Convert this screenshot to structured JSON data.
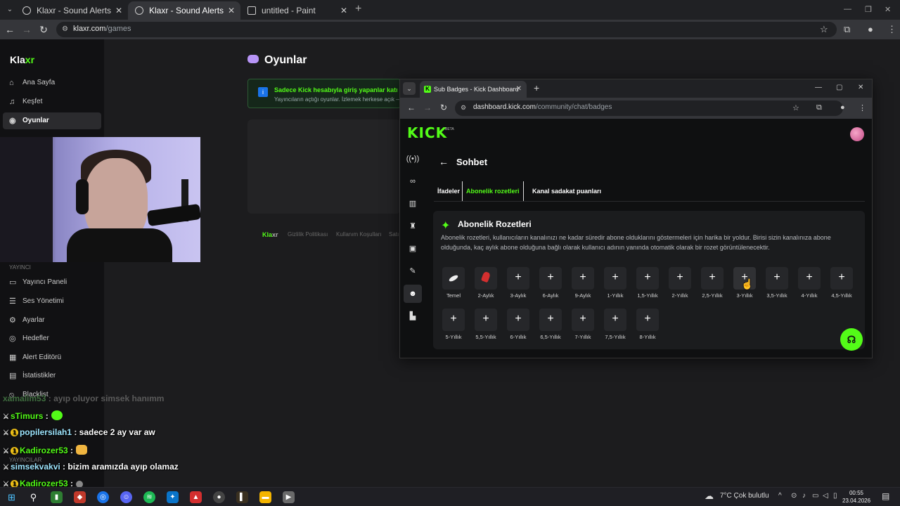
{
  "outer_browser": {
    "tabs": [
      {
        "label": "Klaxr - Sound Alerts",
        "active": false
      },
      {
        "label": "Klaxr - Sound Alerts",
        "active": true
      },
      {
        "label": "untitled - Paint",
        "active": false
      }
    ],
    "url_host": "klaxr.com",
    "url_path": "/games"
  },
  "klaxr": {
    "logo_a": "Kla",
    "logo_b": "xr",
    "nav": [
      {
        "label": "Ana Sayfa",
        "icon": "home-icon"
      },
      {
        "label": "Keşfet",
        "icon": "music-icon"
      },
      {
        "label": "Oyunlar",
        "icon": "gamepad-icon"
      }
    ],
    "section_streamer": "YAYINCI",
    "nav2": [
      {
        "label": "Yayıncı Paneli",
        "icon": "monitor-icon"
      },
      {
        "label": "Ses Yönetimi",
        "icon": "list-icon"
      },
      {
        "label": "Ayarlar",
        "icon": "gear-icon"
      },
      {
        "label": "Hedefler",
        "icon": "target-icon"
      },
      {
        "label": "Alert Editörü",
        "icon": "grid-icon"
      },
      {
        "label": "İstatistikler",
        "icon": "chart-icon"
      },
      {
        "label": "Blacklist",
        "icon": "block-icon"
      }
    ],
    "section_streamers": "YAYINCILAR",
    "page_title": "Oyunlar",
    "info_title": "Sadece Kick hesabıyla giriş yapanlar katı",
    "info_sub": "Yayıncıların açtığı oyunlar. İzlemek herkese açık —",
    "footer_logo_a": "Kla",
    "footer_logo_b": "xr",
    "footer_links": [
      "Gizlilik Politikası",
      "Kullanım Koşulları",
      "Satı"
    ]
  },
  "chat": [
    {
      "user": "xamalim53",
      "text": ": ayıp oluyor simsek hanımm",
      "faded": true
    },
    {
      "user": "sTimurs",
      "text": ":",
      "emote": true
    },
    {
      "user": "popilersilah1",
      "text": ": sadece 2 ay var aw",
      "badge": true,
      "cyan": true
    },
    {
      "user": "Kadirozer53",
      "text": ":",
      "badge": true,
      "emote_hand": true
    },
    {
      "user": "simsekvakvi",
      "text": ": bizim aramızda ayıp olamaz",
      "cyan": true
    },
    {
      "user": "Kadirozer53",
      "text": ":",
      "badge": true
    }
  ],
  "kick_window": {
    "tab_label": "Sub Badges - Kick Dashboard",
    "url_host": "dashboard.kick.com",
    "url_path": "/community/chat/badges",
    "logo": "KICK",
    "logo_beta": "BETA",
    "heading": "Sohbet",
    "tabs": [
      "İfadeler",
      "Abonelik rozetleri",
      "Kanal sadakat puanları"
    ],
    "card_title": "Abonelik Rozetleri",
    "card_desc": "Abonelik rozetleri, kullanıcıların kanalınızı ne kadar süredir abone olduklarını göstermeleri için harika bir yoldur. Birisi sizin kanalınıza abone olduğunda, kaç aylık abone olduğuna bağlı olarak kullanıcı adının yanında otomatik olarak bir rozet görüntülenecektir.",
    "badges_row1": [
      "Temel",
      "2-Aylık",
      "3-Aylık",
      "6-Aylık",
      "9-Aylık",
      "1-Yıllık",
      "1,5-Yıllık",
      "2-Yıllık",
      "2,5-Yıllık",
      "3-Yıllık",
      "3,5-Yıllık",
      "4-Yıllık",
      "4,5-Yıllık"
    ],
    "badges_row2": [
      "5-Yıllık",
      "5,5-Yıllık",
      "6-Yıllık",
      "6,5-Yıllık",
      "7-Yıllık",
      "7,5-Yıllık",
      "8-Yıllık"
    ],
    "add_glyph": "+"
  },
  "taskbar": {
    "weather": "7°C  Çok bulutlu",
    "time": "00:55",
    "date": "23.04.2026"
  },
  "colors": {
    "kick_green": "#53fc18",
    "bg": "#1b1b1d"
  }
}
